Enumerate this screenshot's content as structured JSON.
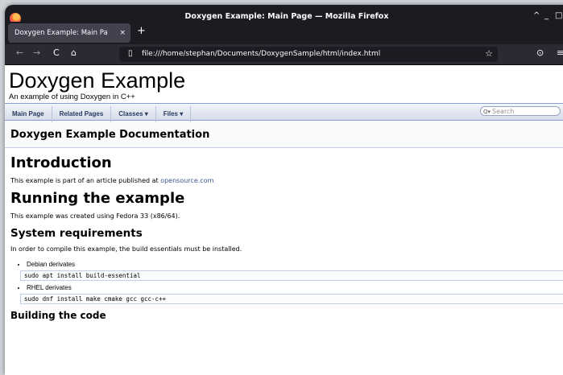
{
  "window": {
    "title": "Doxygen Example: Main Page — Mozilla Firefox",
    "controls": [
      "^",
      "_",
      "□"
    ]
  },
  "tabs": [
    {
      "label": "Doxygen Example: Main Pa",
      "close": "×"
    }
  ],
  "new_tab": "+",
  "navbar": {
    "back": "←",
    "forward": "→",
    "reload": "C",
    "home": "⌂",
    "url": "file:///home/stephan/Documents/DoxygenSample/html/index.html",
    "page_icon": "page-icon",
    "bookmark": "☆",
    "pocket": "⊙",
    "menu": "≡"
  },
  "page": {
    "project_title": "Doxygen Example",
    "project_brief": "An example of using Doxygen in C++",
    "nav_items": [
      "Main Page",
      "Related Pages",
      "Classes ▾",
      "Files ▾"
    ],
    "search_placeholder": "Search",
    "doc_title": "Doxygen Example Documentation",
    "introduction_heading": "Introduction",
    "intro_text": "This example is part of an article published at ",
    "intro_link": "opensource.com",
    "running_heading": "Running the example",
    "running_text": "This example was created using Fedora 33 (x86/64).",
    "sysreq_heading": "System requirements",
    "sysreq_text": "In order to compile this example, the build essentials must be installed.",
    "list": [
      {
        "label": "Debian derivates",
        "code": "sudo apt install build-essential"
      },
      {
        "label": "RHEL derivates",
        "code": "sudo dnf install make cmake gcc gcc-c++"
      }
    ],
    "building_heading": "Building the code"
  }
}
